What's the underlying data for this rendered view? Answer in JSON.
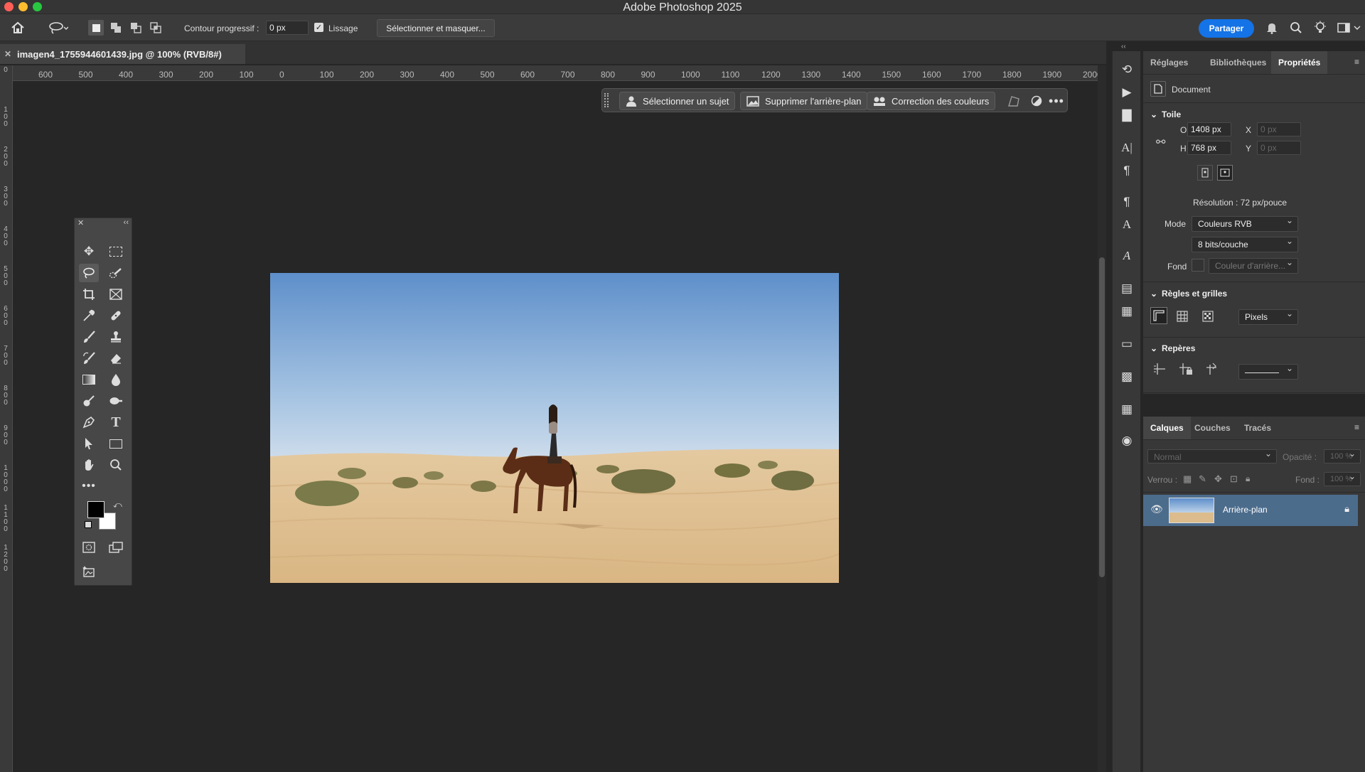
{
  "app": {
    "title": "Adobe Photoshop 2025"
  },
  "options_bar": {
    "feather_label": "Contour progressif :",
    "feather_value": "0 px",
    "antialias_label": "Lissage",
    "select_mask_label": "Sélectionner et masquer...",
    "share_label": "Partager"
  },
  "document": {
    "tab_title": "imagen4_1755944601439.jpg @ 100% (RVB/8#)"
  },
  "ruler": {
    "horizontal_ticks": [
      "600",
      "500",
      "400",
      "300",
      "200",
      "100",
      "0",
      "100",
      "200",
      "300",
      "400",
      "500",
      "600",
      "700",
      "800",
      "900",
      "1000",
      "1100",
      "1200",
      "1300",
      "1400",
      "1500",
      "1600",
      "1700",
      "1800",
      "1900",
      "2000"
    ],
    "vertical_ticks": [
      "0",
      "100",
      "200",
      "300",
      "400",
      "500",
      "600",
      "700",
      "800",
      "900",
      "1000",
      "1100",
      "1200"
    ]
  },
  "context_bar": {
    "select_subject": "Sélectionner un sujet",
    "remove_bg": "Supprimer l'arrière-plan",
    "color_correction": "Correction des couleurs"
  },
  "panels": {
    "tabs": [
      "Réglages",
      "Bibliothèques",
      "Propriétés"
    ],
    "document_label": "Document",
    "canvas_section": "Toile",
    "w_label": "O",
    "w_value": "1408 px",
    "h_label": "H",
    "h_value": "768 px",
    "x_label": "X",
    "x_placeholder": "0 px",
    "y_label": "Y",
    "y_placeholder": "0 px",
    "resolution": "Résolution : 72 px/pouce",
    "mode_label": "Mode",
    "mode_value": "Couleurs RVB",
    "depth_value": "8 bits/couche",
    "fill_label": "Fond",
    "fill_value": "Couleur d'arrière...",
    "rulers_section": "Règles et grilles",
    "units_value": "Pixels",
    "guides_section": "Repères"
  },
  "layers_panel": {
    "tabs": [
      "Calques",
      "Couches",
      "Tracés"
    ],
    "blend_mode": "Normal",
    "opacity_label": "Opacité :",
    "opacity_value": "100 %",
    "lock_label": "Verrou :",
    "fill_label": "Fond :",
    "fill_value": "100 %",
    "layer_name": "Arrière-plan"
  },
  "colors": {
    "accent": "#1473e6",
    "selected_layer": "#4c6c8c",
    "foreground": "#000000",
    "background": "#ffffff"
  }
}
